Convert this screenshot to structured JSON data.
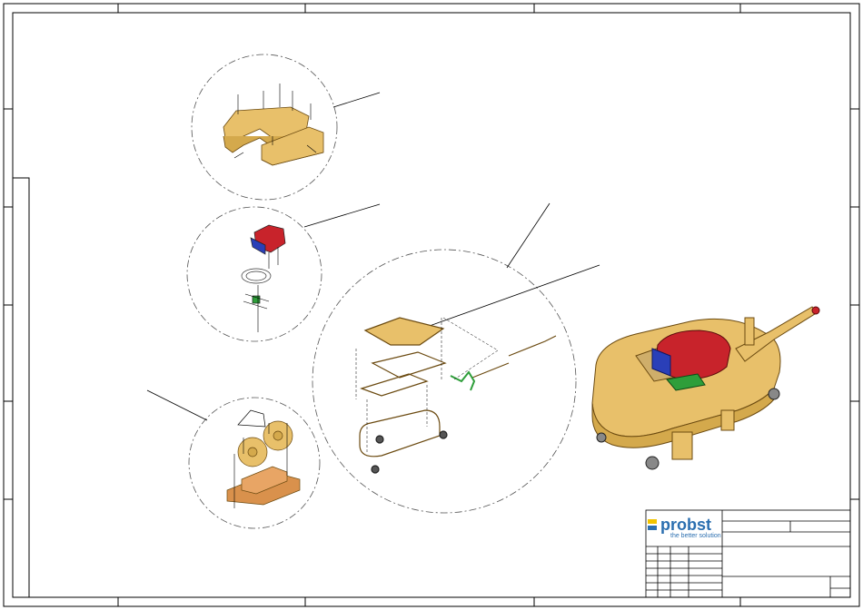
{
  "title_block": {
    "company": "probst",
    "tagline": "the better solution",
    "colors": {
      "brand_blue": "#2b6fb0",
      "brand_yellow": "#f2c400"
    }
  },
  "drawing": {
    "colors": {
      "part_gold": "#e8c06a",
      "part_outline": "#6b4a10",
      "motor_red": "#c8232b",
      "motor_blue": "#2a3fb8",
      "hose_green": "#2e9e3a",
      "line": "#000000"
    }
  }
}
